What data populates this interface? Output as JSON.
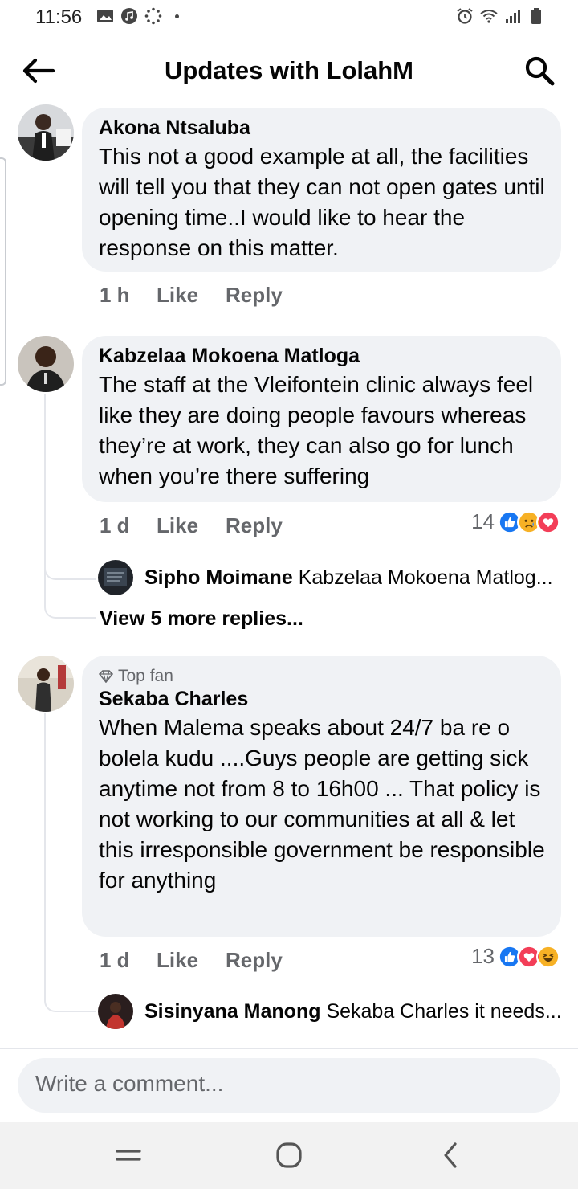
{
  "status_bar": {
    "time": "11:56"
  },
  "header": {
    "title": "Updates with LolahM"
  },
  "comments": [
    {
      "author": "Akona Ntsaluba",
      "text": "This not a good example at all, the facilities will tell you that they can not open gates until opening time..I would like to hear the response on this matter.",
      "time": "1 h",
      "like_label": "Like",
      "reply_label": "Reply"
    },
    {
      "author": "Kabzelaa Mokoena Matloga",
      "text": "The staff at the Vleifontein clinic always feel like they are doing people favours whereas they’re at work, they can also go for lunch when you’re there suffering",
      "time": "1 d",
      "like_label": "Like",
      "reply_label": "Reply",
      "reaction_count": "14",
      "reactions": [
        "like-icon",
        "sad-icon",
        "love-icon"
      ],
      "reply_preview": {
        "author": "Sipho Moimane",
        "text": "Kabzelaa Mokoena Matlog..."
      },
      "view_more": "View 5 more replies..."
    },
    {
      "badge": "Top fan",
      "author": "Sekaba Charles",
      "text": "When Malema speaks about 24/7 ba re o bolela kudu ....Guys people are getting sick anytime not from 8 to 16h00 ... That policy is not working to our communities at all & let this irresponsible government be responsible for anything",
      "time": "1 d",
      "like_label": "Like",
      "reply_label": "Reply",
      "reaction_count": "13",
      "reactions": [
        "like-icon",
        "love-icon",
        "haha-icon"
      ],
      "reply_preview": {
        "author": "Sisinyana Manong",
        "text": "Sekaba Charles  it needs..."
      }
    }
  ],
  "composer": {
    "placeholder": "Write a comment..."
  },
  "colors": {
    "like_blue": "#1877f2",
    "love_red": "#f33e58",
    "reaction_yellow": "#f7b125",
    "bubble_bg": "#f0f2f5",
    "muted_text": "#65676b"
  }
}
